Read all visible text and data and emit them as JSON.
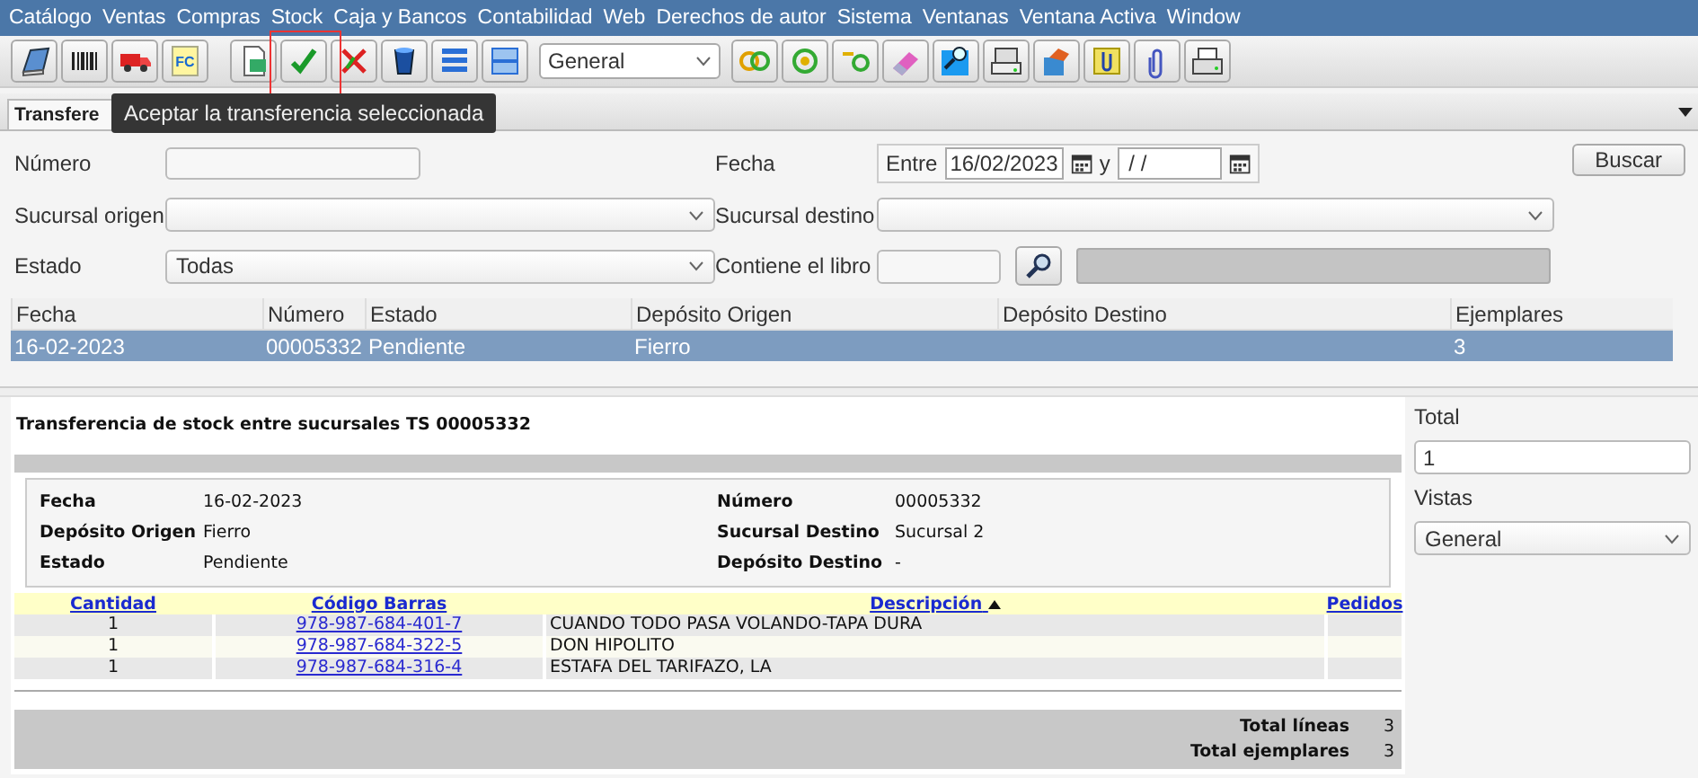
{
  "menu": [
    "Catálogo",
    "Ventas",
    "Compras",
    "Stock",
    "Caja y Bancos",
    "Contabilidad",
    "Web",
    "Derechos de autor",
    "Sistema",
    "Ventanas",
    "Ventana Activa",
    "Window"
  ],
  "toolbar": {
    "items": [
      {
        "kind": "button",
        "highlighted": false
      },
      {
        "kind": "button",
        "highlighted": false
      },
      {
        "kind": "button",
        "highlighted": false
      },
      {
        "kind": "button",
        "label": "FC",
        "highlighted": false
      },
      {
        "kind": "gap"
      },
      {
        "kind": "button",
        "highlighted": false
      },
      {
        "kind": "button",
        "highlighted": true
      },
      {
        "kind": "button",
        "highlighted": false
      },
      {
        "kind": "button",
        "highlighted": false
      },
      {
        "kind": "button",
        "highlighted": false
      },
      {
        "kind": "button",
        "highlighted": false
      },
      {
        "kind": "select",
        "value": "General"
      },
      {
        "kind": "button",
        "highlighted": false
      },
      {
        "kind": "button",
        "highlighted": false
      },
      {
        "kind": "button",
        "highlighted": false
      },
      {
        "kind": "button",
        "highlighted": false
      },
      {
        "kind": "button",
        "highlighted": false
      },
      {
        "kind": "button",
        "highlighted": false
      },
      {
        "kind": "button",
        "highlighted": false
      },
      {
        "kind": "button",
        "highlighted": false
      },
      {
        "kind": "button",
        "highlighted": false
      },
      {
        "kind": "button",
        "highlighted": false
      }
    ]
  },
  "tabs": [
    {
      "label": "Transfere",
      "selected": true
    }
  ],
  "tooltip": "Aceptar la transferencia seleccionada",
  "filters": {
    "numero_label": "Número",
    "fecha_label": "Fecha",
    "between": "Entre",
    "date_from": "16/02/2023",
    "and": "y",
    "date_to": " / /",
    "search_button": "Buscar",
    "origin_label": "Sucursal origen",
    "dest_label": "Sucursal destino",
    "state_label": "Estado",
    "state_value": "Todas",
    "book_label": "Contiene el libro"
  },
  "results": {
    "columns": [
      "Fecha",
      "Número",
      "Estado",
      "Depósito Origen",
      "Depósito Destino",
      "Ejemplares"
    ],
    "rows": [
      {
        "cells": [
          "16-02-2023",
          "00005332",
          "Pendiente",
          "Fierro",
          "",
          "3"
        ],
        "selected": true
      }
    ]
  },
  "report": {
    "title": "Transferencia de stock entre sucursales TS 00005332",
    "details_left": [
      {
        "label": "Fecha",
        "value": "16-02-2023"
      },
      {
        "label": "Depósito Origen",
        "value": "Fierro"
      },
      {
        "label": "Estado",
        "value": "Pendiente"
      }
    ],
    "details_right": [
      {
        "label": "Número",
        "value": "00005332"
      },
      {
        "label": "Sucursal Destino",
        "value": "Sucursal 2"
      },
      {
        "label": "Depósito Destino",
        "value": "-"
      }
    ],
    "columns": [
      {
        "label": "Cantidad",
        "sorted": false
      },
      {
        "label": "Código Barras",
        "sorted": false
      },
      {
        "label": "Descripción",
        "sorted": true
      },
      {
        "label": "Pedidos",
        "sorted": false
      }
    ],
    "rows": [
      {
        "quantity": "1",
        "barcode": "978-987-684-401-7",
        "description": "CUANDO TODO PASA VOLANDO-TAPA DURA"
      },
      {
        "quantity": "1",
        "barcode": "978-987-684-322-5",
        "description": "DON HIPOLITO"
      },
      {
        "quantity": "1",
        "barcode": "978-987-684-316-4",
        "description": "ESTAFA DEL TARIFAZO, LA"
      }
    ],
    "totals": [
      {
        "label": "Total líneas",
        "value": "3"
      },
      {
        "label": "Total ejemplares",
        "value": "3"
      }
    ]
  },
  "side": {
    "total_label": "Total",
    "total_value": "1",
    "views_label": "Vistas",
    "views_value": "General"
  }
}
